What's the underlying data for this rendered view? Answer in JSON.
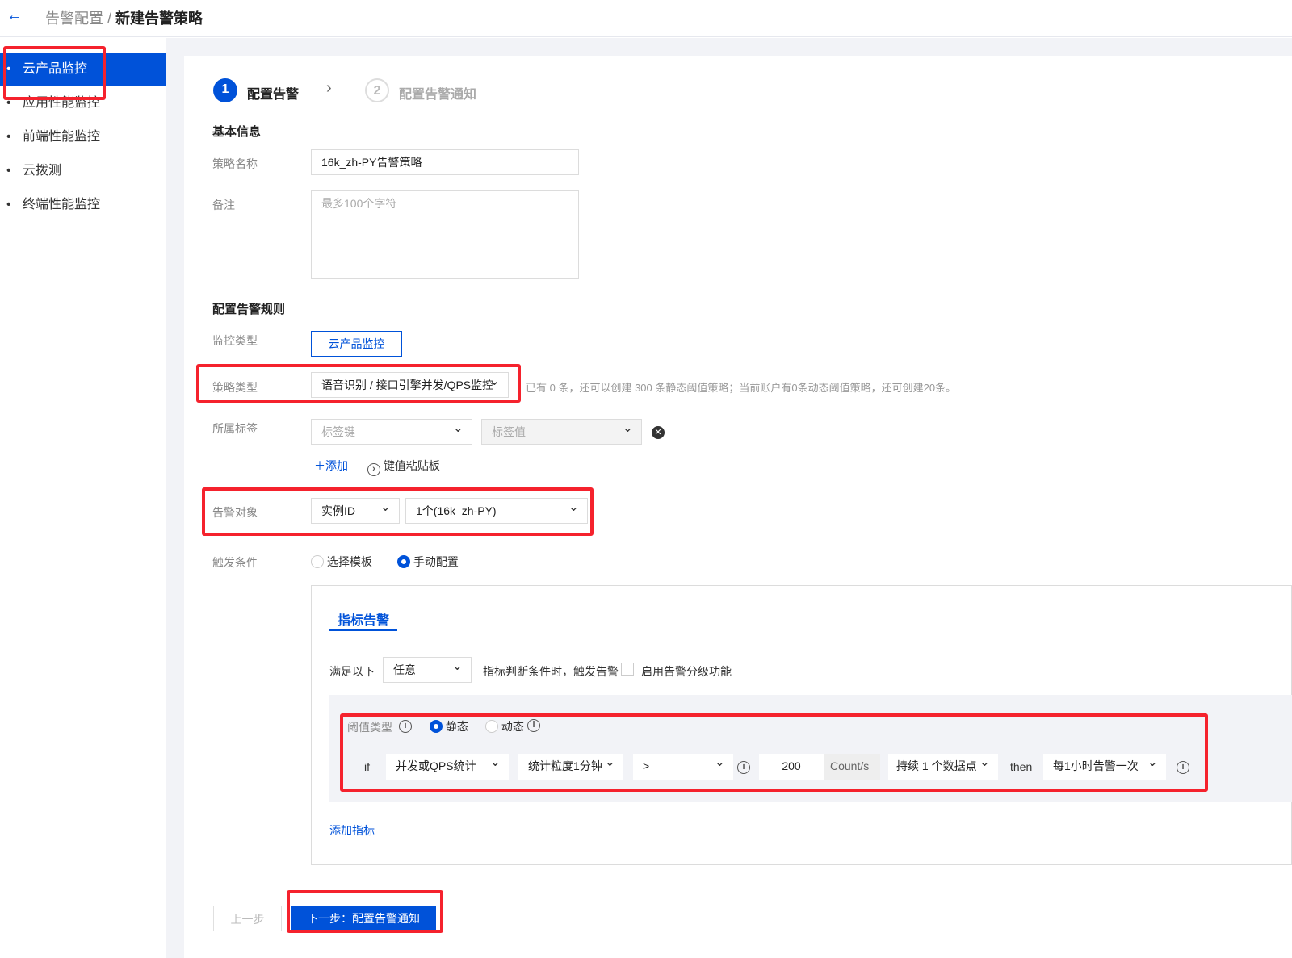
{
  "header": {
    "back_icon": "arrow-left-icon",
    "breadcrumb_parent": "告警配置",
    "breadcrumb_sep": " / ",
    "breadcrumb_current": "新建告警策略"
  },
  "sidebar": {
    "items": [
      {
        "label": "云产品监控",
        "active": true
      },
      {
        "label": "应用性能监控"
      },
      {
        "label": "前端性能监控"
      },
      {
        "label": "云拨测"
      },
      {
        "label": "终端性能监控"
      }
    ]
  },
  "steps": [
    {
      "num": "1",
      "label": "配置告警",
      "active": true
    },
    {
      "num": "2",
      "label": "配置告警通知",
      "active": false
    }
  ],
  "basic": {
    "title": "基本信息",
    "name_label": "策略名称",
    "name_value": "16k_zh-PY告警策略",
    "remark_label": "备注",
    "remark_placeholder": "最多100个字符"
  },
  "rules": {
    "title": "配置告警规则",
    "monitor_type_label": "监控类型",
    "monitor_type_value": "云产品监控",
    "policy_type_label": "策略类型",
    "policy_type_value": "语音识别 / 接口引擎并发/QPS监控",
    "policy_hint": "已有 0 条，还可以创建 300 条静态阈值策略；当前账户有0条动态阈值策略，还可创建20条。",
    "tag_label": "所属标签",
    "tag_key_placeholder": "标签键",
    "tag_value_placeholder": "标签值",
    "add_label": "添加",
    "paste_label": "键值粘贴板",
    "object_label": "告警对象",
    "object_type": "实例ID",
    "object_value": "1个(16k_zh-PY)",
    "trigger_label": "触发条件",
    "trigger_options": [
      {
        "label": "选择模板",
        "selected": false
      },
      {
        "label": "手动配置",
        "selected": true
      }
    ]
  },
  "metric": {
    "tab": "指标告警",
    "satisfy_prefix": "满足以下",
    "satisfy_value": "任意",
    "satisfy_suffix": "指标判断条件时，触发告警",
    "grading_label": "启用告警分级功能",
    "threshold_label": "阈值类型",
    "static_label": "静态",
    "dynamic_label": "动态",
    "if": "if",
    "metric_value": "并发或QPS统计",
    "granularity": "统计粒度1分钟",
    "operator": ">",
    "threshold": "200",
    "unit": "Count/s",
    "duration": "持续 1 个数据点",
    "then": "then",
    "frequency": "每1小时告警一次",
    "add_metric": "添加指标"
  },
  "footer": {
    "prev": "上一步",
    "next": "下一步：配置告警通知"
  },
  "colors": {
    "primary": "#0052d9",
    "highlight": "#f5222d"
  }
}
